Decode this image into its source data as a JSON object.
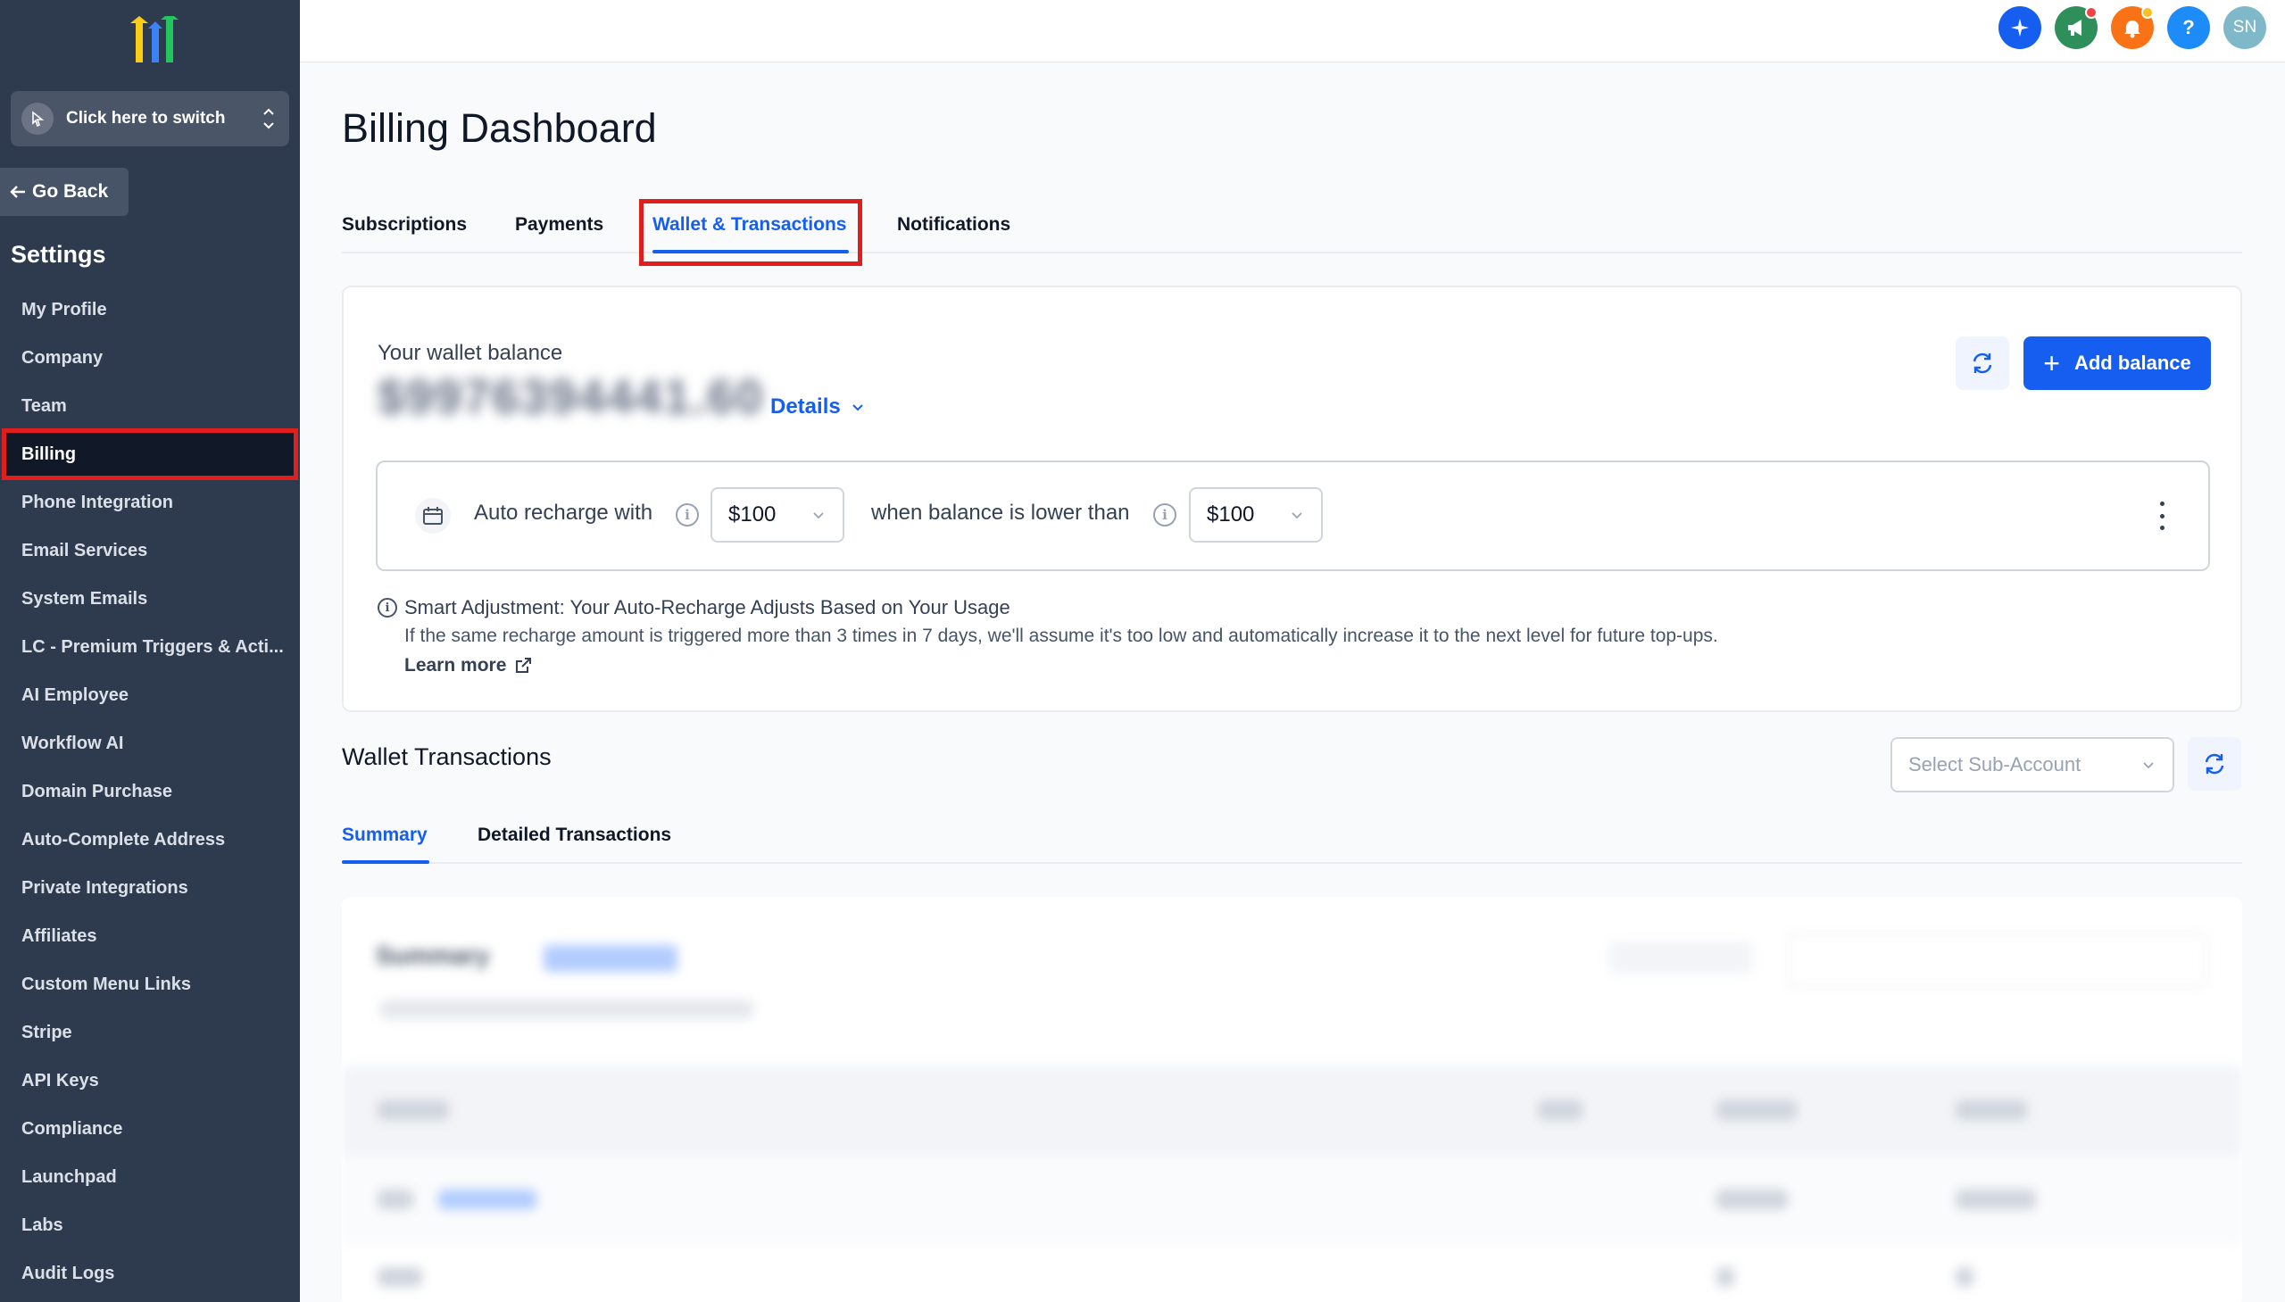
{
  "sidebar": {
    "switcher_label": "Click here to switch",
    "go_back": "Go Back",
    "settings_title": "Settings",
    "items": [
      {
        "label": "My Profile"
      },
      {
        "label": "Company"
      },
      {
        "label": "Team"
      },
      {
        "label": "Billing",
        "active": true
      },
      {
        "label": "Phone Integration"
      },
      {
        "label": "Email Services"
      },
      {
        "label": "System Emails"
      },
      {
        "label": "LC - Premium Triggers & Acti..."
      },
      {
        "label": "AI Employee"
      },
      {
        "label": "Workflow AI"
      },
      {
        "label": "Domain Purchase"
      },
      {
        "label": "Auto-Complete Address"
      },
      {
        "label": "Private Integrations"
      },
      {
        "label": "Affiliates"
      },
      {
        "label": "Custom Menu Links"
      },
      {
        "label": "Stripe"
      },
      {
        "label": "API Keys"
      },
      {
        "label": "Compliance"
      },
      {
        "label": "Launchpad"
      },
      {
        "label": "Labs"
      },
      {
        "label": "Audit Logs"
      }
    ]
  },
  "topbar": {
    "icons": [
      {
        "name": "ai-sparkle-icon",
        "color": "#155eef"
      },
      {
        "name": "megaphone-icon",
        "color": "#2f8f5b"
      },
      {
        "name": "bell-icon",
        "color": "#f97316"
      },
      {
        "name": "help-icon",
        "color": "#1d8cf8",
        "glyph": "?"
      },
      {
        "name": "avatar",
        "color": "#7fb9c9",
        "glyph": "SN"
      }
    ]
  },
  "page": {
    "title": "Billing Dashboard",
    "tabs": [
      "Subscriptions",
      "Payments",
      "Wallet & Transactions",
      "Notifications"
    ],
    "active_tab": "Wallet & Transactions"
  },
  "wallet": {
    "label": "Your wallet balance",
    "balance": "$9976394441.60",
    "details": "Details",
    "add_balance": "Add balance",
    "recharge": {
      "prefix": "Auto recharge with",
      "amount": "$100",
      "middle": "when balance is lower than",
      "threshold": "$100"
    },
    "smart": {
      "title": "Smart Adjustment: Your Auto-Recharge Adjusts Based on Your Usage",
      "desc": "If the same recharge amount is triggered more than 3 times in 7 days, we'll assume it's too low and automatically increase it to the next level for future top-ups.",
      "learn_more": "Learn more"
    }
  },
  "transactions": {
    "title": "Wallet Transactions",
    "sub_account_placeholder": "Select Sub-Account",
    "tabs": [
      "Summary",
      "Detailed Transactions"
    ],
    "active_tab": "Summary",
    "summary_title": "Summary"
  }
}
